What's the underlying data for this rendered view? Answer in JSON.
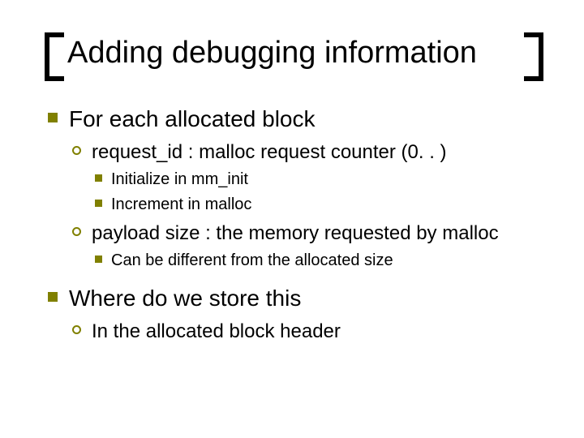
{
  "title": "Adding debugging information",
  "bullets": {
    "b1": {
      "text": "For each allocated block",
      "sub": {
        "s1": {
          "text": "request_id : malloc request counter (0. . )",
          "sub": {
            "t1": "Initialize in mm_init",
            "t2": "Increment in malloc"
          }
        },
        "s2": {
          "text": "payload size : the memory requested by malloc",
          "sub": {
            "t1": "Can be different from the allocated size"
          }
        }
      }
    },
    "b2": {
      "text": "Where do we store this",
      "sub": {
        "s1": {
          "text": "In the allocated block header"
        }
      }
    }
  }
}
